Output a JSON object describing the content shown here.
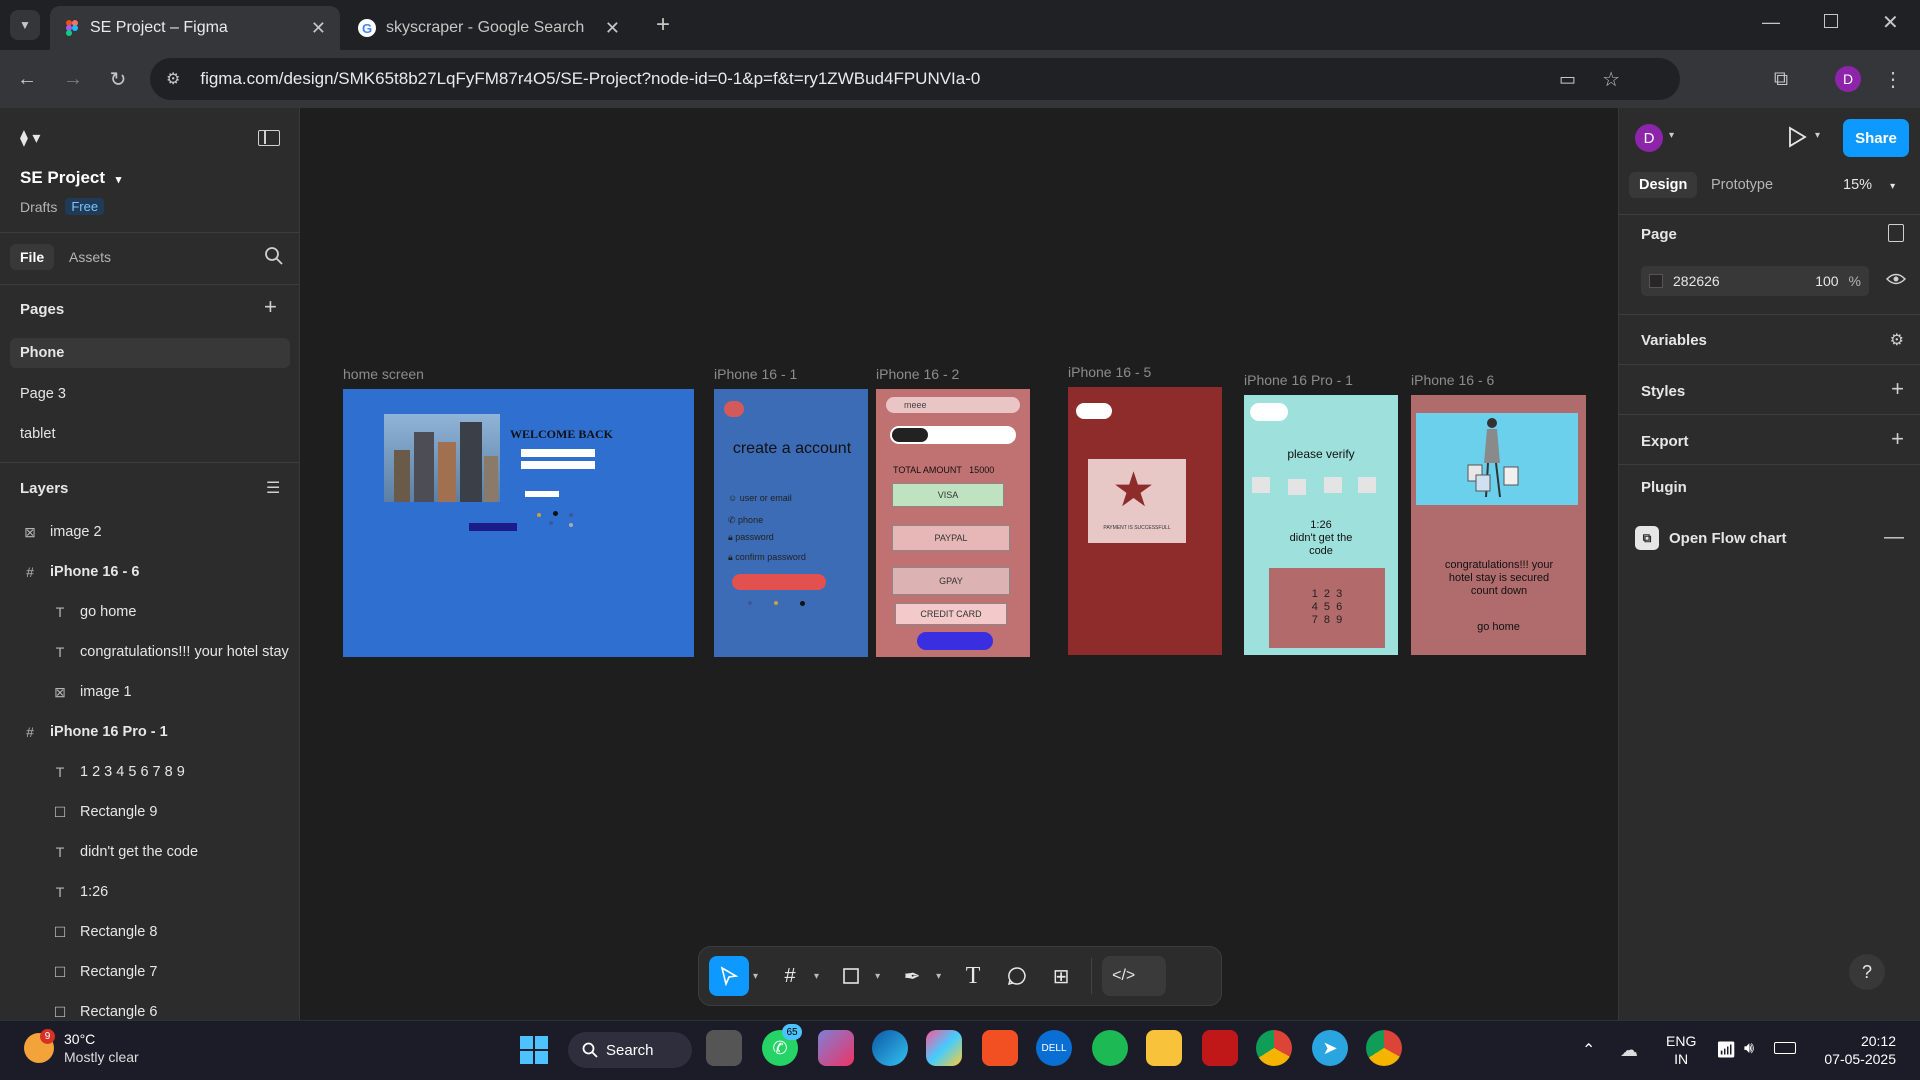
{
  "browser": {
    "tabs": [
      {
        "title": "SE Project – Figma",
        "active": true
      },
      {
        "title": "skyscraper - Google Search",
        "active": false
      }
    ],
    "url": "figma.com/design/SMK65t8b27LqFyFM87r4O5/SE-Project?node-id=0-1&p=f&t=ry1ZWBud4FPUNVIa-0",
    "profile_initial": "D"
  },
  "left_panel": {
    "file_name": "SE Project",
    "drafts_label": "Drafts",
    "plan_badge": "Free",
    "tabs": [
      "File",
      "Assets"
    ],
    "pages_header": "Pages",
    "pages": [
      "Phone",
      "Page 3",
      "tablet"
    ],
    "layers_header": "Layers",
    "layers": [
      {
        "type": "image",
        "name": "image 2",
        "indent": 0
      },
      {
        "type": "frame",
        "name": "iPhone 16 - 6",
        "indent": 0
      },
      {
        "type": "text",
        "name": "go home",
        "indent": 1
      },
      {
        "type": "text",
        "name": "congratulations!!! your hotel stay",
        "indent": 1
      },
      {
        "type": "image",
        "name": "image 1",
        "indent": 1
      },
      {
        "type": "frame",
        "name": "iPhone 16 Pro - 1",
        "indent": 0
      },
      {
        "type": "text",
        "name": "1 2 3 4 5 6 7 8 9",
        "indent": 1
      },
      {
        "type": "rect",
        "name": "Rectangle 9",
        "indent": 1
      },
      {
        "type": "text",
        "name": "didn't get the code",
        "indent": 1
      },
      {
        "type": "text",
        "name": "1:26",
        "indent": 1
      },
      {
        "type": "rect",
        "name": "Rectangle 8",
        "indent": 1
      },
      {
        "type": "rect",
        "name": "Rectangle 7",
        "indent": 1
      },
      {
        "type": "rect",
        "name": "Rectangle 6",
        "indent": 1
      }
    ]
  },
  "right_panel": {
    "avatar": "D",
    "share_label": "Share",
    "tabs": [
      "Design",
      "Prototype"
    ],
    "zoom": "15%",
    "page_label": "Page",
    "page_color": "282626",
    "page_opacity": "100",
    "percent": "%",
    "sections": [
      "Variables",
      "Styles",
      "Export"
    ],
    "plugin_header": "Plugin",
    "plugin_name": "Open Flow chart"
  },
  "canvas": {
    "frames": [
      {
        "label": "home screen",
        "color": "#2f6fd0"
      },
      {
        "label": "iPhone 16 - 1",
        "color": "#3c6cb5"
      },
      {
        "label": "iPhone 16 - 2",
        "color": "#c07272"
      },
      {
        "label": "iPhone 16 - 5",
        "color": "#8e2b2b"
      },
      {
        "label": "iPhone 16 Pro - 1",
        "color": "#9ee0dc"
      },
      {
        "label": "iPhone 16 - 6",
        "color": "#b06c6c"
      }
    ],
    "home": {
      "welcome": "WELCOME BACK"
    },
    "create": {
      "title": "create a account",
      "fields": [
        "user or email",
        "phone",
        "password",
        "confirm password"
      ]
    },
    "payment": {
      "search": "meee",
      "total": "TOTAL AMOUNT   15000",
      "methods": [
        "VISA",
        "PAYPAL",
        "GPAY",
        "CREDIT CARD"
      ]
    },
    "success": {
      "message": "PAYMENT IS SUCCESSFULL"
    },
    "verify": {
      "title": "please verify",
      "timer": "1:26",
      "resend": "didn't get the code",
      "keypad": [
        "1  2  3",
        "4  5  6",
        "7  8  9"
      ]
    },
    "congrats": {
      "text": "congratulations!!! your hotel stay is secured count down",
      "go_home": "go home"
    }
  },
  "taskbar": {
    "weather_temp": "30°C",
    "weather_desc": "Mostly clear",
    "weather_badge": "9",
    "search_label": "Search",
    "whatsapp_badge": "65",
    "lang": "ENG",
    "region": "IN",
    "time": "20:12",
    "date": "07-05-2025"
  }
}
